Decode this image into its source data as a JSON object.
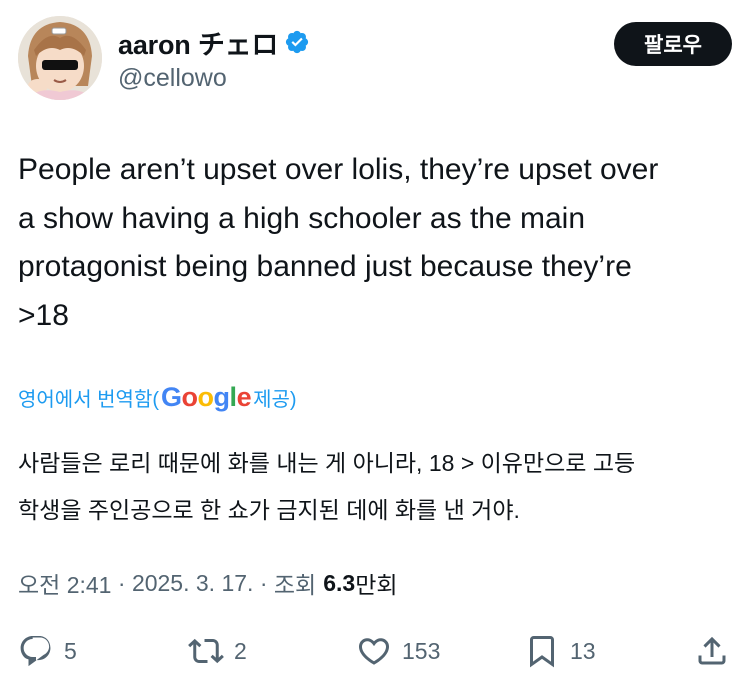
{
  "author": {
    "display_name": "aaron チェロ",
    "handle": "@cellowo",
    "avatar": "anime-avatar-with-sunglasses",
    "verified_icon": "verified-badge-icon"
  },
  "follow_button": {
    "label": "팔로우"
  },
  "tweet": {
    "text": "People aren’t upset over lolis, they’re upset over\na show having a high schooler as the main\nprotagonist being banned just because they’re\n>18"
  },
  "translation": {
    "prefix": "영어에서 번역함(",
    "google": "Google",
    "suffix": " 제공)",
    "text": "사람들은 로리 때문에 화를 내는 게 아니라, 18 > 이유만으로 고등\n학생을 주인공으로 한 쇼가 금지된 데에 화를 낸 거야."
  },
  "meta": {
    "time": "오전 2:41",
    "separator": " · ",
    "date": "2025. 3. 17.",
    "views_label": "조회",
    "views_number": "6.3",
    "views_unit": "만회"
  },
  "actions": {
    "replies": "5",
    "retweets": "2",
    "likes": "153",
    "bookmarks": "13"
  },
  "colors": {
    "link_blue": "#1d9bf0",
    "verified_blue": "#1d9bf0",
    "text_primary": "#0f1419",
    "text_secondary": "#536471"
  }
}
